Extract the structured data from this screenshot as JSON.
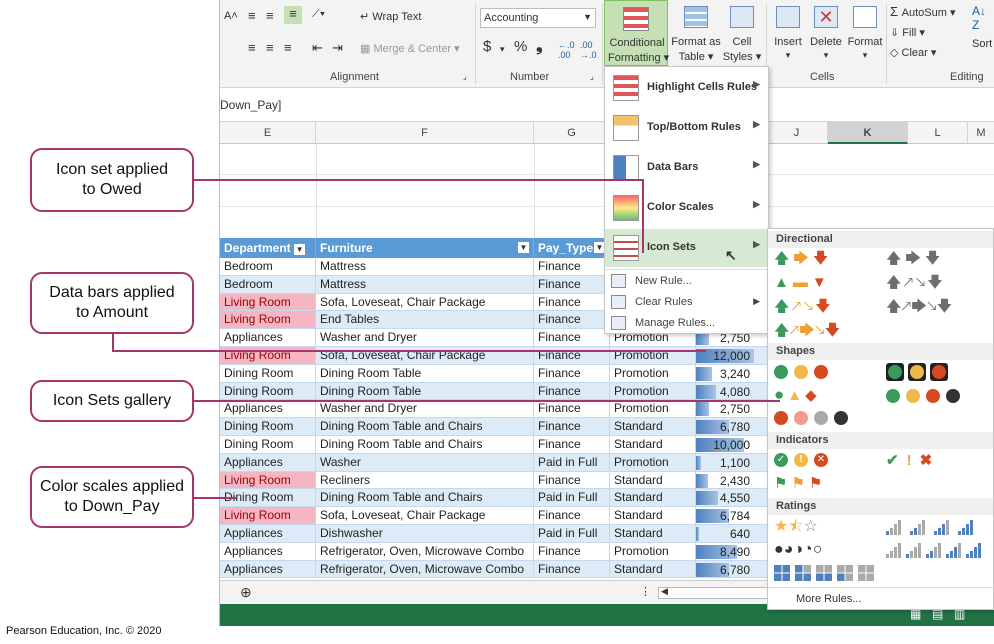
{
  "ribbon": {
    "wrap_text": "Wrap Text",
    "merge_center": "Merge & Center",
    "number_format": "Accounting",
    "currency_symbol": "$",
    "percent_symbol": "%",
    "comma_symbol": "❟",
    "alignment_label": "Alignment",
    "number_label": "Number",
    "cells_label": "Cells",
    "editing_label": "Editing",
    "conditional_formatting": [
      "Conditional",
      "Formatting"
    ],
    "format_as_table": [
      "Format as",
      "Table"
    ],
    "cell_styles": [
      "Cell",
      "Styles"
    ],
    "insert": "Insert",
    "delete": "Delete",
    "format": "Format",
    "autosum": "AutoSum",
    "fill": "Fill",
    "clear": "Clear",
    "sort": "Sort"
  },
  "formula_bar": {
    "name_fragment": "Down_Pay]"
  },
  "columns": [
    "E",
    "F",
    "G",
    "J",
    "K",
    "L",
    "M"
  ],
  "table": {
    "headers": [
      "Department",
      "Furniture",
      "Pay_Type"
    ],
    "rows": [
      {
        "dept": "Bedroom",
        "furn": "Mattress",
        "pay": "Finance",
        "type": "",
        "amt": "",
        "hl": false
      },
      {
        "dept": "Bedroom",
        "furn": "Mattress",
        "pay": "Finance",
        "type": "",
        "amt": "",
        "hl": false
      },
      {
        "dept": "Living Room",
        "furn": "Sofa, Loveseat, Chair Package",
        "pay": "Finance",
        "type": "",
        "amt": "",
        "hl": true
      },
      {
        "dept": "Living Room",
        "furn": "End Tables",
        "pay": "Finance",
        "type": "",
        "amt": "",
        "hl": true
      },
      {
        "dept": "Appliances",
        "furn": "Washer and Dryer",
        "pay": "Finance",
        "type": "Promotion",
        "amt": "2,750",
        "hl": false
      },
      {
        "dept": "Living Room",
        "furn": "Sofa, Loveseat, Chair Package",
        "pay": "Finance",
        "type": "Promotion",
        "amt": "12,000",
        "hl": true
      },
      {
        "dept": "Dining Room",
        "furn": "Dining Room Table",
        "pay": "Finance",
        "type": "Promotion",
        "amt": "3,240",
        "hl": false
      },
      {
        "dept": "Dining Room",
        "furn": "Dining Room Table",
        "pay": "Finance",
        "type": "Promotion",
        "amt": "4,080",
        "hl": false
      },
      {
        "dept": "Appliances",
        "furn": "Washer and Dryer",
        "pay": "Finance",
        "type": "Promotion",
        "amt": "2,750",
        "hl": false
      },
      {
        "dept": "Dining Room",
        "furn": "Dining Room Table and Chairs",
        "pay": "Finance",
        "type": "Standard",
        "amt": "6,780",
        "hl": false
      },
      {
        "dept": "Dining Room",
        "furn": "Dining Room Table and Chairs",
        "pay": "Finance",
        "type": "Standard",
        "amt": "10,000",
        "hl": false
      },
      {
        "dept": "Appliances",
        "furn": "Washer",
        "pay": "Paid in Full",
        "type": "Promotion",
        "amt": "1,100",
        "hl": false
      },
      {
        "dept": "Living Room",
        "furn": "Recliners",
        "pay": "Finance",
        "type": "Standard",
        "amt": "2,430",
        "hl": true
      },
      {
        "dept": "Dining Room",
        "furn": "Dining Room Table and Chairs",
        "pay": "Paid in Full",
        "type": "Standard",
        "amt": "4,550",
        "hl": false
      },
      {
        "dept": "Living Room",
        "furn": "Sofa, Loveseat, Chair Package",
        "pay": "Finance",
        "type": "Standard",
        "amt": "6,784",
        "hl": true
      },
      {
        "dept": "Appliances",
        "furn": "Dishwasher",
        "pay": "Paid in Full",
        "type": "Standard",
        "amt": "640",
        "hl": false
      },
      {
        "dept": "Appliances",
        "furn": "Refrigerator, Oven, Microwave Combo",
        "pay": "Finance",
        "type": "Promotion",
        "amt": "8,490",
        "hl": false
      },
      {
        "dept": "Appliances",
        "furn": "Refrigerator, Oven, Microwave Combo",
        "pay": "Finance",
        "type": "Standard",
        "amt": "6,780",
        "hl": false
      }
    ]
  },
  "amount_bar_fractions": [
    0,
    0,
    0,
    0,
    0.23,
    1.0,
    0.27,
    0.34,
    0.23,
    0.57,
    0.83,
    0.09,
    0.2,
    0.38,
    0.57,
    0.05,
    0.71,
    0.57
  ],
  "cf_menu": {
    "items": [
      "Highlight Cells Rules",
      "Top/Bottom Rules",
      "Data Bars",
      "Color Scales",
      "Icon Sets"
    ],
    "small_items": [
      "New Rule...",
      "Clear Rules",
      "Manage Rules..."
    ]
  },
  "gallery": {
    "sections": [
      "Directional",
      "Shapes",
      "Indicators",
      "Ratings"
    ],
    "more_rules": "More Rules..."
  },
  "callouts": {
    "owed": [
      "Icon set applied",
      "to Owed"
    ],
    "amount": [
      "Data bars applied",
      "to Amount"
    ],
    "gallery": [
      "Icon Sets gallery"
    ],
    "downpay": [
      "Color scales applied",
      "to Down_Pay"
    ]
  },
  "credit": "Pearson Education, Inc. © 2020",
  "colors": {
    "accent": "#a7356b",
    "table_header": "#5b9bd5",
    "excel_green": "#217346",
    "highlight": "#f4b6c2"
  }
}
